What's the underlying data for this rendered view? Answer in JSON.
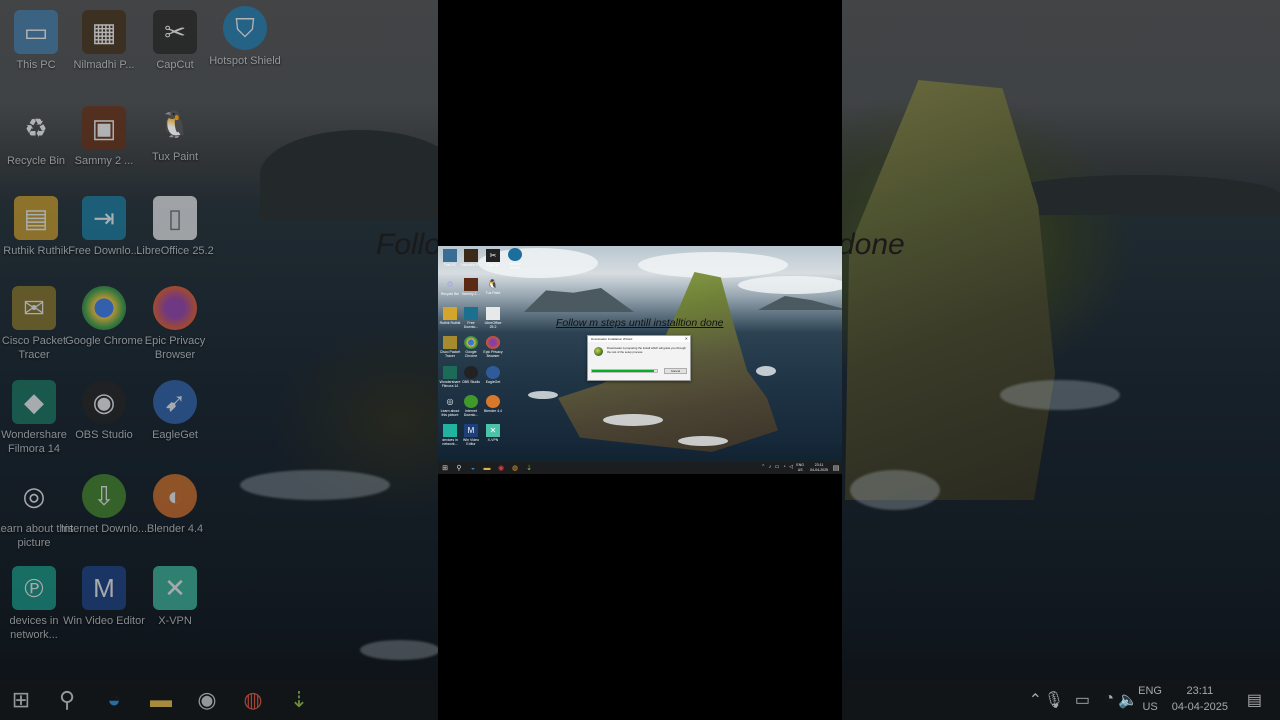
{
  "overlay_title": "Follow m steps untill installtion done",
  "overlay_title_bg_left": "Follo",
  "overlay_title_bg_right": "done",
  "desktop_icons": [
    {
      "label": "This PC",
      "icon": "computer-icon"
    },
    {
      "label": "Nilmadhi P...",
      "icon": "video-thumbnail-icon"
    },
    {
      "label": "CapCut",
      "icon": "capcut-icon"
    },
    {
      "label": "Hotspot Shield",
      "icon": "shield-icon"
    },
    {
      "label": "Recycle Bin",
      "icon": "recycle-bin-icon"
    },
    {
      "label": "Sammy 2 ...",
      "icon": "image-thumbnail-icon"
    },
    {
      "label": "Tux Paint",
      "icon": "penguin-icon"
    },
    {
      "label": "Ruthik Ruthik",
      "icon": "user-folder-icon"
    },
    {
      "label": "Free Downlo...",
      "icon": "download-manager-icon"
    },
    {
      "label": "LibreOffice 25.2",
      "icon": "document-icon"
    },
    {
      "label": "Cisco Packet Tracer",
      "icon": "envelope-icon"
    },
    {
      "label": "Google Chrome",
      "icon": "chrome-icon"
    },
    {
      "label": "Epic Privacy Browser",
      "icon": "epic-browser-icon"
    },
    {
      "label": "Wondershare Filmora 14",
      "icon": "filmora-icon"
    },
    {
      "label": "OBS Studio",
      "icon": "obs-icon"
    },
    {
      "label": "EagleGet",
      "icon": "eagle-icon"
    },
    {
      "label": "Learn about this picture",
      "icon": "camera-icon"
    },
    {
      "label": "Internet Downlo...",
      "icon": "internet-download-icon"
    },
    {
      "label": "Blender 4.4",
      "icon": "blender-icon"
    },
    {
      "label": "devices in network...",
      "icon": "network-devices-icon"
    },
    {
      "label": "Win Video Editor",
      "icon": "video-editor-icon"
    },
    {
      "label": "X-VPN",
      "icon": "vpn-icon"
    }
  ],
  "dialog": {
    "title": "Downloader Installation Wizard",
    "message": "Downloader is preparing the Install which will guide you through the rest of the setup process.",
    "progress": 0.95,
    "cancel_label": "Cancel"
  },
  "taskbar": {
    "apps": [
      "start-icon",
      "search-icon",
      "edge-icon",
      "file-explorer-icon",
      "obs-icon",
      "chrome-icon",
      "downloader-icon"
    ],
    "language": "ENG",
    "region": "US",
    "time": "23:11",
    "date": "04-04-2025"
  },
  "colors": {
    "progress_fill": "#06b025",
    "taskbar": "#1c1d1f",
    "letterbox": "#000000"
  }
}
